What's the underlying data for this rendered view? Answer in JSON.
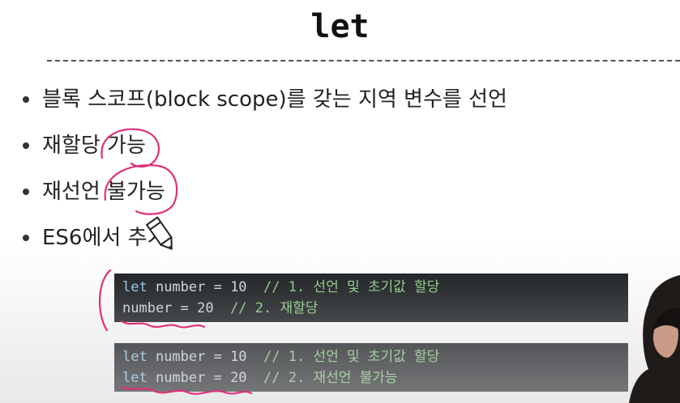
{
  "slide": {
    "title": "let",
    "bullets": [
      "블록 스코프(block scope)를 갖는 지역 변수를 선언",
      "재할당 가능",
      "재선언 불가능",
      "ES6에서 추가"
    ]
  },
  "code_blocks": [
    {
      "lines": [
        {
          "keyword": "let",
          "code": " number = 10  ",
          "comment": "// 1. 선언 및 초기값 할당"
        },
        {
          "keyword": "",
          "code": "number = 20  ",
          "comment": "// 2. 재할당"
        }
      ]
    },
    {
      "lines": [
        {
          "keyword": "let",
          "code": " number = 10  ",
          "comment": "// 1. 선언 및 초기값 할당"
        },
        {
          "keyword": "let",
          "code": " number = 20  ",
          "comment": "// 2. 재선언 불가능"
        }
      ]
    }
  ],
  "colors": {
    "background": "#ffffff",
    "code_background": "#0f1216",
    "code_text": "#cfd6dc",
    "keyword": "#8fc3e6",
    "comment": "#88c97e",
    "annotation_pen": "#e0307a"
  },
  "icons": [
    "pencil-cursor-icon"
  ]
}
